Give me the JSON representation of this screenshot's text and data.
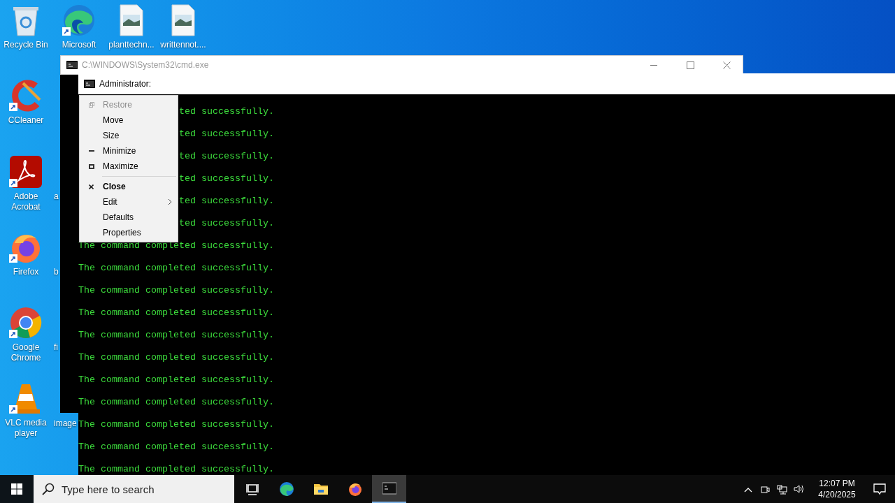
{
  "desktop_icons": [
    {
      "label": "Recycle Bin",
      "kind": "recycle"
    },
    {
      "label": "CCleaner",
      "kind": "ccleaner"
    },
    {
      "label": "Adobe Acrobat",
      "kind": "acrobat"
    },
    {
      "label": "Firefox",
      "kind": "firefox"
    },
    {
      "label": "Google Chrome",
      "kind": "chrome"
    },
    {
      "label": "VLC media player",
      "kind": "vlc"
    }
  ],
  "desktop_top_icons": [
    {
      "label": "Microsoft",
      "kind": "edge"
    },
    {
      "label": "planttechn...",
      "kind": "image"
    },
    {
      "label": "writtennot....",
      "kind": "image"
    }
  ],
  "partial_labels": [
    "a",
    "b",
    "fi",
    "image"
  ],
  "back_window": {
    "title": "C:\\WINDOWS\\System32\\cmd.exe"
  },
  "front_window": {
    "title": "Administrator:",
    "lines": [
      {
        "text": "ted successfully.",
        "kind": "cut"
      },
      {
        "text": "ted successfully.",
        "kind": "cut"
      },
      {
        "text": "ted successfully.",
        "kind": "cut"
      },
      {
        "text": "ted successfully.",
        "kind": "cut"
      },
      {
        "text": "ted successfully.",
        "kind": "cut"
      },
      {
        "text": "ted successfully.",
        "kind": "cut"
      },
      {
        "text": "The command completed successfully.",
        "kind": "full"
      },
      {
        "text": "The command completed successfully.",
        "kind": "full"
      },
      {
        "text": "The command completed successfully.",
        "kind": "full"
      },
      {
        "text": "The command completed successfully.",
        "kind": "full"
      },
      {
        "text": "The command completed successfully.",
        "kind": "full"
      },
      {
        "text": "The command completed successfully.",
        "kind": "full"
      },
      {
        "text": "The command completed successfully.",
        "kind": "full"
      },
      {
        "text": "The command completed successfully.",
        "kind": "full"
      },
      {
        "text": "The command completed successfully.",
        "kind": "full"
      },
      {
        "text": "The command completed successfully.",
        "kind": "full"
      },
      {
        "text": "The command completed successfully.",
        "kind": "full"
      }
    ]
  },
  "system_menu": {
    "items": [
      {
        "label": "Restore",
        "kind": "restore",
        "disabled": true,
        "bold": false
      },
      {
        "label": "Move",
        "kind": "plain",
        "disabled": false,
        "bold": false
      },
      {
        "label": "Size",
        "kind": "plain",
        "disabled": false,
        "bold": false
      },
      {
        "label": "Minimize",
        "kind": "minimize",
        "disabled": false,
        "bold": false
      },
      {
        "label": "Maximize",
        "kind": "maximize",
        "disabled": false,
        "bold": false
      },
      {
        "kind": "separator"
      },
      {
        "label": "Close",
        "kind": "close",
        "disabled": false,
        "bold": true
      },
      {
        "label": "Edit",
        "kind": "submenu",
        "disabled": false,
        "bold": false
      },
      {
        "label": "Defaults",
        "kind": "plain",
        "disabled": false,
        "bold": false
      },
      {
        "label": "Properties",
        "kind": "plain",
        "disabled": false,
        "bold": false
      }
    ]
  },
  "taskbar": {
    "search": {
      "placeholder": "Type here to search"
    },
    "apps": [
      {
        "kind": "taskview",
        "selected": false
      },
      {
        "kind": "edge",
        "selected": false
      },
      {
        "kind": "explorer",
        "selected": false
      },
      {
        "kind": "firefox",
        "selected": false
      },
      {
        "kind": "cmd",
        "selected": true
      }
    ],
    "clock": {
      "time": "12:07 PM",
      "date": "4/20/2025"
    }
  }
}
